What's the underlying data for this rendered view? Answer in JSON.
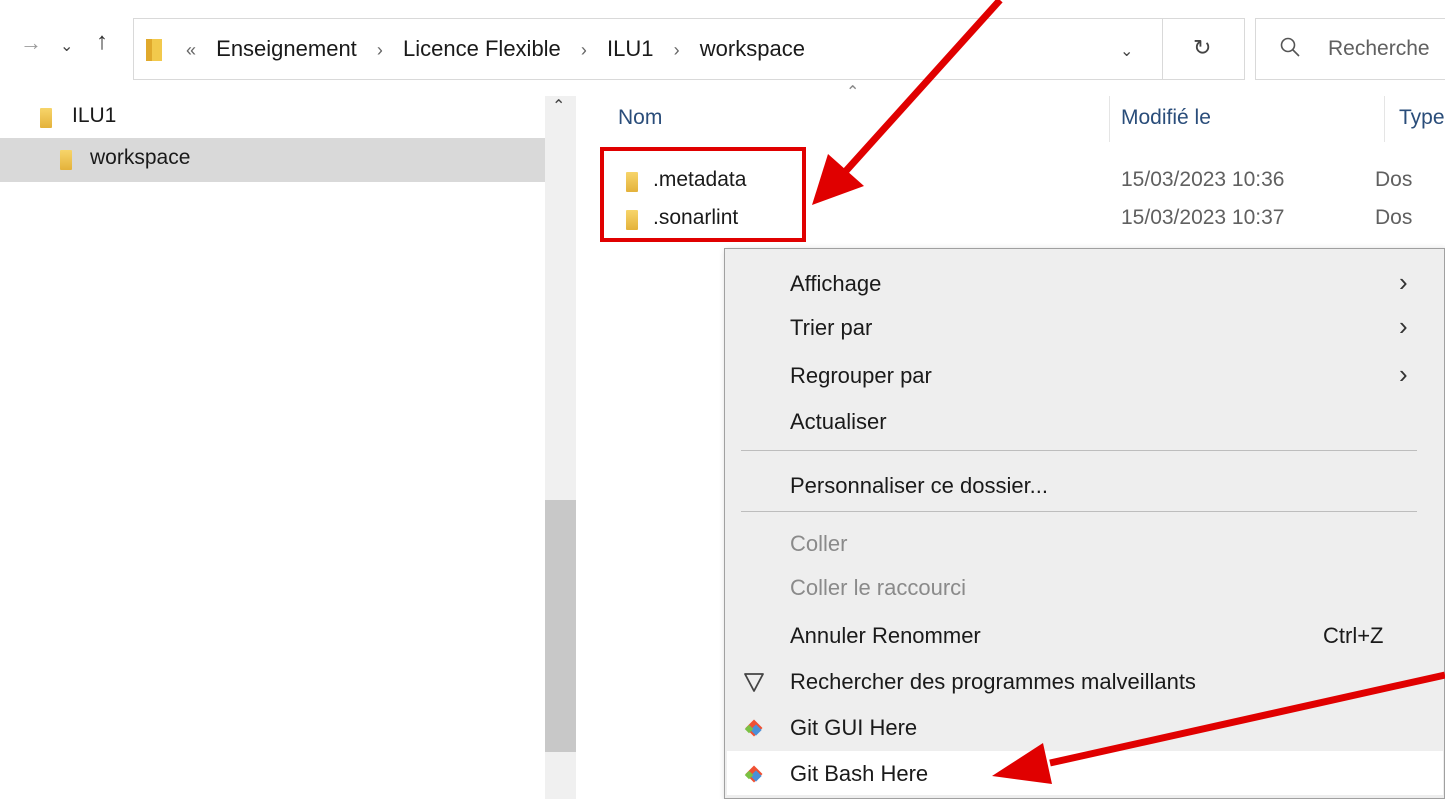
{
  "breadcrumb": {
    "overflow": "«",
    "items": [
      "Enseignement",
      "Licence Flexible",
      "ILU1",
      "workspace"
    ],
    "separator": "›"
  },
  "nav_buttons": {
    "forward": "→",
    "recent": "⌄",
    "up": "↑",
    "address_dropdown": "⌄",
    "refresh": "↻",
    "search_glyph": "⚲"
  },
  "search": {
    "placeholder": "Recherche"
  },
  "nav_pane": {
    "items": [
      {
        "label": "ILU1",
        "selected": false
      },
      {
        "label": "workspace",
        "selected": true
      }
    ],
    "scroll_up": "⌃"
  },
  "file_list": {
    "sort_caret": "⌃",
    "columns": {
      "name": "Nom",
      "modified": "Modifié le",
      "type": "Type"
    },
    "rows": [
      {
        "name": ".metadata",
        "modified": "15/03/2023 10:36",
        "type": "Dos"
      },
      {
        "name": ".sonarlint",
        "modified": "15/03/2023 10:37",
        "type": "Dos"
      }
    ]
  },
  "context_menu": {
    "items": [
      {
        "label": "Affichage",
        "submenu": "›"
      },
      {
        "label": "Trier par",
        "submenu": "›"
      },
      {
        "label": "Regrouper par",
        "submenu": "›"
      },
      {
        "label": "Actualiser"
      },
      {
        "label": "Personnaliser ce dossier..."
      },
      {
        "label": "Coller",
        "disabled": true
      },
      {
        "label": "Coller le raccourci",
        "disabled": true
      },
      {
        "label": "Annuler Renommer",
        "shortcut": "Ctrl+Z"
      },
      {
        "label": "Rechercher des programmes malveillants",
        "icon": "shield-icon"
      },
      {
        "label": "Git GUI Here",
        "icon": "git-icon"
      },
      {
        "label": "Git Bash Here",
        "icon": "git-icon",
        "hovered": true
      }
    ]
  },
  "colors": {
    "annotation_red": "#e00000",
    "folder_yellow": "#f2c94c",
    "column_header": "#2a4d7a",
    "git_orange": "#f05133",
    "git_blue": "#4a90d9"
  }
}
